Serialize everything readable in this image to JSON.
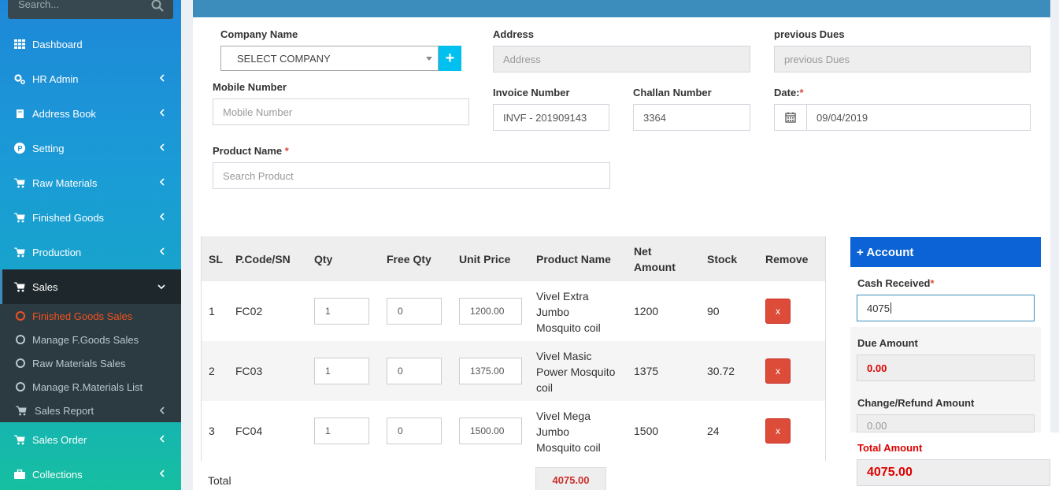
{
  "search": {
    "placeholder": "Search..."
  },
  "sidebar": {
    "items": [
      {
        "label": "Dashboard"
      },
      {
        "label": "HR Admin"
      },
      {
        "label": "Address Book"
      },
      {
        "label": "Setting"
      },
      {
        "label": "Raw Materials"
      },
      {
        "label": "Finished Goods"
      },
      {
        "label": "Production"
      },
      {
        "label": "Sales"
      },
      {
        "label": "Sales Order"
      },
      {
        "label": "Collections"
      }
    ],
    "sales_sub": [
      {
        "label": "Finished Goods Sales"
      },
      {
        "label": "Manage F.Goods Sales"
      },
      {
        "label": "Raw Materials Sales"
      },
      {
        "label": "Manage R.Materials List"
      },
      {
        "label": "Sales Report"
      }
    ]
  },
  "form": {
    "company_label": "Company Name",
    "company_value": "SELECT COMPANY",
    "address_label": "Address",
    "address_placeholder": "Address",
    "dues_label": "previous Dues",
    "dues_placeholder": "previous Dues",
    "mobile_label": "Mobile Number",
    "mobile_placeholder": "Mobile Number",
    "invoice_label": "Invoice Number",
    "invoice_value": "INVF - 201909143",
    "challan_label": "Challan Number",
    "challan_value": "3364",
    "date_label": "Date:",
    "date_req": "*",
    "date_value": "09/04/2019",
    "product_label": "Product Name",
    "product_req": "*",
    "product_placeholder": "Search Product",
    "plus": "+"
  },
  "table": {
    "headers": [
      "SL",
      "P.Code/SN",
      "Qty",
      "Free Qty",
      "Unit Price",
      "Product Name",
      "Net",
      "Amount",
      "Stock",
      "Remove"
    ],
    "rows": [
      {
        "sl": "1",
        "code": "FC02",
        "qty": "1",
        "free": "0",
        "price": "1200.00",
        "name1": "Vivel Extra",
        "name2": "Jumbo",
        "name3": "Mosquito coil",
        "net": "1200",
        "stock": "90",
        "remove": "x"
      },
      {
        "sl": "2",
        "code": "FC03",
        "qty": "1",
        "free": "0",
        "price": "1375.00",
        "name1": "Vivel Masic",
        "name2": "Power Mosquito",
        "name3": "coil",
        "net": "1375",
        "stock": "30.72",
        "remove": "x"
      },
      {
        "sl": "3",
        "code": "FC04",
        "qty": "1",
        "free": "0",
        "price": "1500.00",
        "name1": "Vivel Mega",
        "name2": "Jumbo",
        "name3": "Mosquito coil",
        "net": "1500",
        "stock": "24",
        "remove": "x"
      }
    ],
    "total_label": "Total",
    "total_value": "4075.00"
  },
  "account": {
    "title": "+ Account",
    "cash_label": "Cash Received",
    "cash_req": "*",
    "cash_value": "4075",
    "due_label": "Due Amount",
    "due_value": "0.00",
    "change_label": "Change/Refund Amount",
    "change_value": "0.00",
    "total_label": "Total Amount",
    "total_value": "4075.00"
  },
  "colors": {
    "brand": "#3c8dbc",
    "accent": "#00c0ef",
    "danger": "#dd4b39",
    "account_head": "#0b63d6"
  }
}
